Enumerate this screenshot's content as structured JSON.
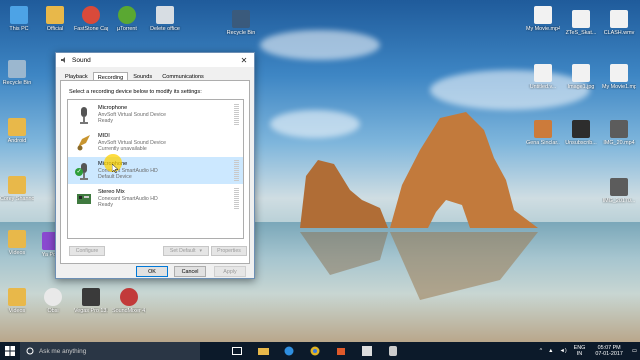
{
  "desktop": {
    "icons_left": [
      {
        "label": "This PC",
        "icon": "this-pc-icon",
        "color": "#4da3e6"
      },
      {
        "label": "Official",
        "icon": "folder-icon",
        "color": "#e8b84a"
      },
      {
        "label": "FastStone Capture",
        "icon": "faststone-icon",
        "color": "#d94a3a"
      },
      {
        "label": "µTorrent",
        "icon": "utorrent-icon",
        "color": "#5aa832"
      },
      {
        "label": "Delete office",
        "icon": "file-icon",
        "color": "#d7dde3"
      },
      {
        "label": "Recycle Bin",
        "icon": "recycle-bin-icon",
        "color": "#9bb7cf"
      },
      {
        "label": "Android",
        "icon": "folder-icon",
        "color": "#e8b84a"
      },
      {
        "label": "Corey Shanno",
        "icon": "folder-icon",
        "color": "#e8b84a"
      },
      {
        "label": "Videos",
        "icon": "folder-icon",
        "color": "#e8b84a"
      },
      {
        "label": "Videos",
        "icon": "folder-icon",
        "color": "#e8b84a"
      }
    ],
    "icons_bottom": [
      {
        "label": "Obsi",
        "icon": "obs-icon",
        "color": "#e9e9e9"
      },
      {
        "label": "Vegas Pro 13.0 (64-bit)",
        "icon": "vegas-icon",
        "color": "#3a3a3a"
      },
      {
        "label": "SoundMixer 4.0",
        "icon": "soundmixer-icon",
        "color": "#c23a3a"
      },
      {
        "label": "Ya Poin",
        "icon": "yahoo-icon",
        "color": "#8a4ad0"
      }
    ],
    "icons_right": [
      {
        "label": "My Movie.mp4",
        "icon": "video-file-icon",
        "color": "#f2f2f2"
      },
      {
        "label": "ZTeS_Skat...",
        "icon": "video-file-icon",
        "color": "#f2f2f2"
      },
      {
        "label": "CLASH.wmv",
        "icon": "video-file-icon",
        "color": "#f2f2f2"
      },
      {
        "label": "Untitled.v...",
        "icon": "file-icon",
        "color": "#f2f2f2"
      },
      {
        "label": "Image1.jpg",
        "icon": "image-file-icon",
        "color": "#f2f2f2"
      },
      {
        "label": "My Movie1.mp4",
        "icon": "video-file-icon",
        "color": "#f2f2f2"
      },
      {
        "label": "Gena Sinclar...",
        "icon": "shortcut-icon",
        "color": "#cc7b3b"
      },
      {
        "label": "Unsubscrib...",
        "icon": "camera-icon",
        "color": "#2d2d2d"
      },
      {
        "label": "IMG_20.mp4",
        "icon": "video-file-icon",
        "color": "#5c5c5c"
      },
      {
        "label": "IMG_20170...",
        "icon": "video-file-icon",
        "color": "#5c5c5c"
      }
    ],
    "icon_top_center": {
      "label": "Recycle Bin",
      "icon": "screen-icon"
    }
  },
  "dialog": {
    "title": "Sound",
    "close_glyph": "✕",
    "tabs": [
      {
        "label": "Playback",
        "active": false
      },
      {
        "label": "Recording",
        "active": true
      },
      {
        "label": "Sounds",
        "active": false
      },
      {
        "label": "Communications",
        "active": false
      }
    ],
    "instruction": "Select a recording device below to modify its settings:",
    "devices": [
      {
        "name": "Microphone",
        "driver": "AnvSoft Virtual Sound Device",
        "status": "Ready",
        "icon": "microphone-icon",
        "selected": false,
        "default": false
      },
      {
        "name": "MIDI",
        "driver": "AnvSoft Virtual Sound Device",
        "status": "Currently unavailable",
        "icon": "midi-icon",
        "selected": false,
        "default": false
      },
      {
        "name": "Microphone",
        "driver": "Conexant SmartAudio HD",
        "status": "Default Device",
        "icon": "microphone-icon",
        "selected": true,
        "default": true
      },
      {
        "name": "Stereo Mix",
        "driver": "Conexant SmartAudio HD",
        "status": "Ready",
        "icon": "sound-card-icon",
        "selected": false,
        "default": false
      }
    ],
    "buttons": {
      "configure": "Configure",
      "set_default": "Set Default",
      "properties": "Properties",
      "ok": "OK",
      "cancel": "Cancel",
      "apply": "Apply"
    }
  },
  "taskbar": {
    "search_placeholder": "Ask me anything",
    "pinned": [
      "task-view-icon",
      "folder-icon",
      "edge-icon",
      "chrome-icon",
      "store-icon",
      "windows-icon",
      "app-icon"
    ],
    "language": "ENG",
    "region": "IN",
    "time": "05:07 PM",
    "date": "07-01-2017"
  },
  "colors": {
    "taskbar": "#0c1a2a",
    "selected_row": "#cce8ff",
    "accent": "#0078d7"
  }
}
